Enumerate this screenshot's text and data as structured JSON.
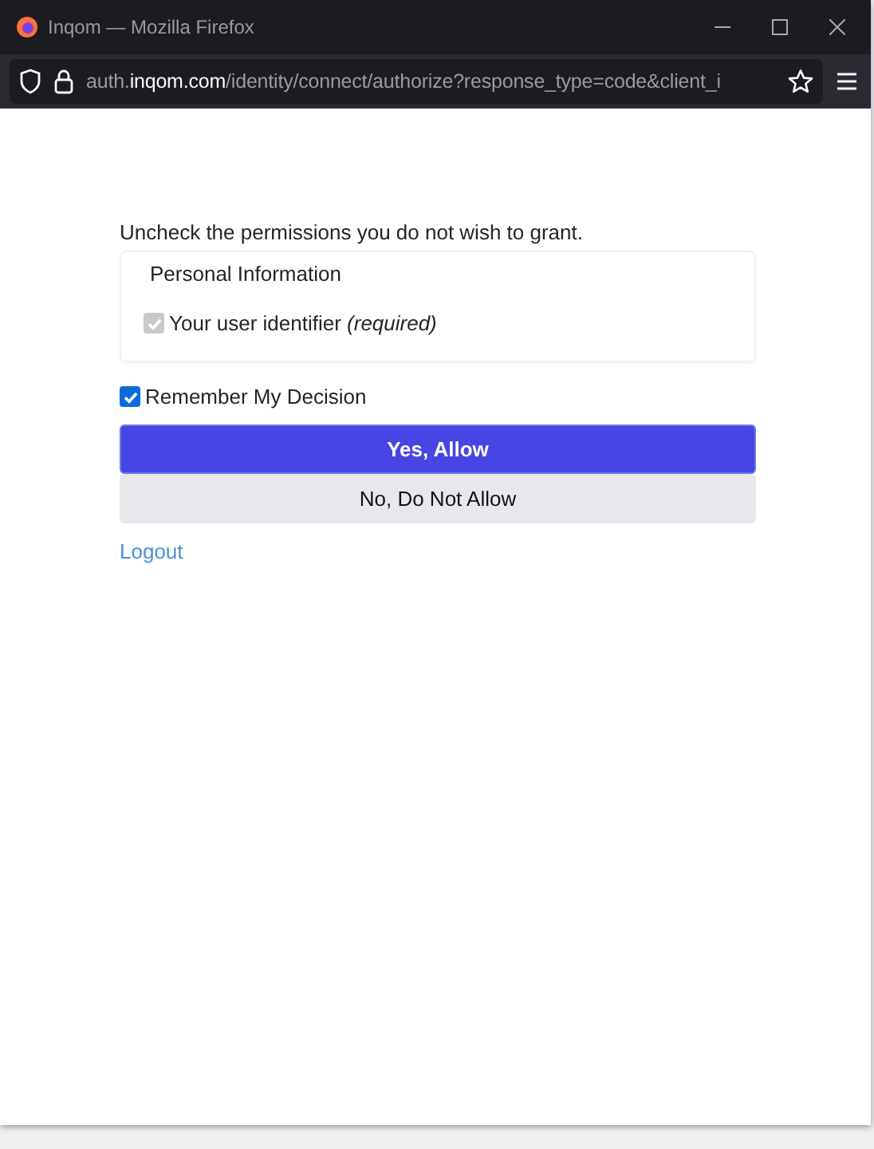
{
  "window": {
    "title": "Inqom — Mozilla Firefox"
  },
  "address_bar": {
    "url_prefix": "auth.",
    "url_domain": "inqom.com",
    "url_path": "/identity/connect/authorize?response_type=code&client_i"
  },
  "consent": {
    "instruction": "Uncheck the permissions you do not wish to grant.",
    "scope_group": {
      "title": "Personal Information",
      "items": [
        {
          "label": "Your user identifier *(required)*",
          "checked": true,
          "disabled": true
        }
      ]
    },
    "remember": {
      "label": "Remember My Decision",
      "checked": true
    },
    "buttons": [
      {
        "label": "Yes, Allow",
        "kind": "primary"
      },
      {
        "label": "No, Do Not Allow",
        "kind": "secondary"
      }
    ],
    "logout_link": "Logout"
  }
}
